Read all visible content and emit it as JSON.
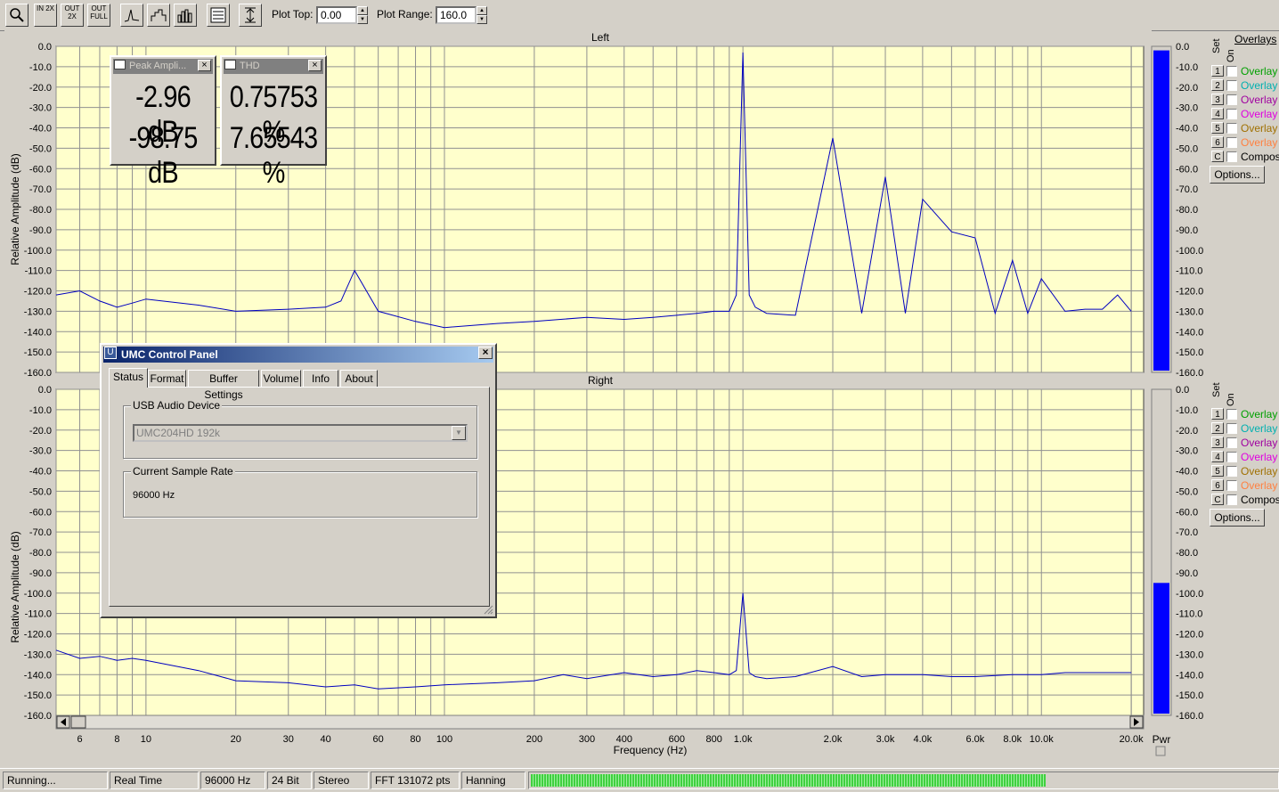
{
  "toolbar": {
    "plot_top_label": "Plot Top:",
    "plot_top_value": "0.00",
    "plot_range_label": "Plot Range:",
    "plot_range_value": "160.0",
    "buttons": [
      {
        "name": "zoom-tool-button",
        "icon": "magnifier-icon",
        "text": ""
      },
      {
        "name": "zoom-in-2x-button",
        "icon": "zoom-in-icon",
        "text": "IN 2X"
      },
      {
        "name": "zoom-out-2x-button",
        "icon": "zoom-out-icon",
        "text": "OUT 2X"
      },
      {
        "name": "zoom-out-full-button",
        "icon": "zoom-full-icon",
        "text": "OUT FULL"
      },
      {
        "name": "spectrum-line-button",
        "icon": "line-plot-icon",
        "text": ""
      },
      {
        "name": "spectrum-step-button",
        "icon": "step-plot-icon",
        "text": ""
      },
      {
        "name": "spectrum-bar-button",
        "icon": "bar-plot-icon",
        "text": ""
      },
      {
        "name": "settings-panel-button",
        "icon": "panel-icon",
        "text": ""
      },
      {
        "name": "vertical-scale-button",
        "icon": "vertical-arrows-icon",
        "text": ""
      }
    ]
  },
  "plots": {
    "left_title": "Left",
    "right_title": "Right",
    "y_axis_label": "Relative Amplitude (dB)",
    "x_axis_label": "Frequency (Hz)",
    "y_ticks": [
      "0.0",
      "-10.0",
      "-20.0",
      "-30.0",
      "-40.0",
      "-50.0",
      "-60.0",
      "-70.0",
      "-80.0",
      "-90.0",
      "-100.0",
      "-110.0",
      "-120.0",
      "-130.0",
      "-140.0",
      "-150.0",
      "-160.0"
    ],
    "x_ticks": [
      "6",
      "8",
      "10",
      "20",
      "30",
      "40",
      "60",
      "80",
      "100",
      "200",
      "300",
      "400",
      "600",
      "800",
      "1.0k",
      "2.0k",
      "3.0k",
      "4.0k",
      "6.0k",
      "8.0k",
      "10.0k",
      "20.0k"
    ],
    "pwr_label": "Pwr",
    "colors": {
      "trace": "#0000c0",
      "background": "#ffffcc",
      "grid": "#808080",
      "meter": "#0000ff"
    }
  },
  "chart_data": [
    {
      "type": "line",
      "title": "Left",
      "xlabel": "Frequency (Hz)",
      "ylabel": "Relative Amplitude (dB)",
      "xscale": "log",
      "xlim": [
        5,
        22000
      ],
      "ylim": [
        -160,
        0
      ],
      "grid": true,
      "series": [
        {
          "x": [
            5,
            6,
            7,
            8,
            9,
            10,
            15,
            20,
            30,
            40,
            45,
            50,
            60,
            80,
            100,
            150,
            200,
            300,
            400,
            500,
            600,
            700,
            800,
            900,
            950,
            1000,
            1050,
            1100,
            1200,
            1500,
            2000,
            2500,
            3000,
            3500,
            4000,
            5000,
            6000,
            7000,
            8000,
            9000,
            10000,
            12000,
            14000,
            16000,
            18000,
            20000
          ],
          "y": [
            -122,
            -120,
            -125,
            -128,
            -126,
            -124,
            -127,
            -130,
            -129,
            -128,
            -125,
            -110,
            -130,
            -135,
            -138,
            -136,
            -135,
            -133,
            -134,
            -133,
            -132,
            -131,
            -130,
            -130,
            -122,
            -3,
            -122,
            -128,
            -131,
            -132,
            -45,
            -131,
            -64,
            -131,
            -75,
            -91,
            -94,
            -131,
            -105,
            -131,
            -114,
            -130,
            -129,
            -129,
            -122,
            -130
          ]
        }
      ]
    },
    {
      "type": "line",
      "title": "Right",
      "xlabel": "Frequency (Hz)",
      "ylabel": "Relative Amplitude (dB)",
      "xscale": "log",
      "xlim": [
        5,
        22000
      ],
      "ylim": [
        -160,
        0
      ],
      "grid": true,
      "series": [
        {
          "x": [
            5,
            6,
            7,
            8,
            9,
            10,
            15,
            20,
            30,
            40,
            50,
            60,
            80,
            100,
            150,
            200,
            250,
            300,
            400,
            500,
            600,
            700,
            800,
            900,
            950,
            1000,
            1050,
            1100,
            1200,
            1500,
            2000,
            2500,
            3000,
            4000,
            5000,
            6000,
            8000,
            10000,
            12000,
            14000,
            16000,
            18000,
            20000
          ],
          "y": [
            -128,
            -132,
            -131,
            -133,
            -132,
            -133,
            -138,
            -143,
            -144,
            -146,
            -145,
            -147,
            -146,
            -145,
            -144,
            -143,
            -140,
            -142,
            -139,
            -141,
            -140,
            -138,
            -139,
            -140,
            -138,
            -100,
            -139,
            -141,
            -142,
            -141,
            -136,
            -141,
            -140,
            -140,
            -141,
            -141,
            -140,
            -140,
            -139,
            -139,
            -139,
            -139,
            -139
          ]
        }
      ]
    }
  ],
  "right_panel": {
    "overlays_title": "Overlays",
    "set_label": "Set",
    "on_label": "On",
    "options_label": "Options...",
    "rows": [
      {
        "num": "1",
        "label": "Overlay",
        "color": "#00a000"
      },
      {
        "num": "2",
        "label": "Overlay",
        "color": "#00b0b0"
      },
      {
        "num": "3",
        "label": "Overlay",
        "color": "#a000a0"
      },
      {
        "num": "4",
        "label": "Overlay",
        "color": "#e000e0"
      },
      {
        "num": "5",
        "label": "Overlay",
        "color": "#a07000"
      },
      {
        "num": "6",
        "label": "Overlay",
        "color": "#ff8040"
      },
      {
        "num": "C",
        "label": "Compos",
        "color": "#000000"
      }
    ],
    "meter_scale": [
      "0.0",
      "-10.0",
      "-20.0",
      "-30.0",
      "-40.0",
      "-50.0",
      "-60.0",
      "-70.0",
      "-80.0",
      "-90.0",
      "-100.0",
      "-110.0",
      "-120.0",
      "-130.0",
      "-140.0",
      "-150.0",
      "-160.0"
    ],
    "left_level_db": -2,
    "right_level_db": -95
  },
  "meters": {
    "peak": {
      "title": "Peak Ampli...",
      "value1": "-2.96 dB",
      "value2": "-98.75 dB"
    },
    "thd": {
      "title": "THD",
      "value1": "0.75753 %",
      "value2": "7.65543 %"
    }
  },
  "umc": {
    "title": "UMC Control Panel",
    "icon_letter": "U",
    "tabs": [
      "Status",
      "Format",
      "Buffer Settings",
      "Volume",
      "Info",
      "About"
    ],
    "usb_group_title": "USB Audio Device",
    "usb_device_value": "UMC204HD 192k",
    "rate_group_title": "Current Sample Rate",
    "rate_value": "96000 Hz"
  },
  "statusbar": {
    "state": "Running...",
    "mode": "Real Time",
    "rate": "96000 Hz",
    "bits": "24 Bit",
    "channels": "Stereo",
    "fft": "FFT 131072 pts",
    "window": "Hanning",
    "level_fraction": 0.69
  }
}
